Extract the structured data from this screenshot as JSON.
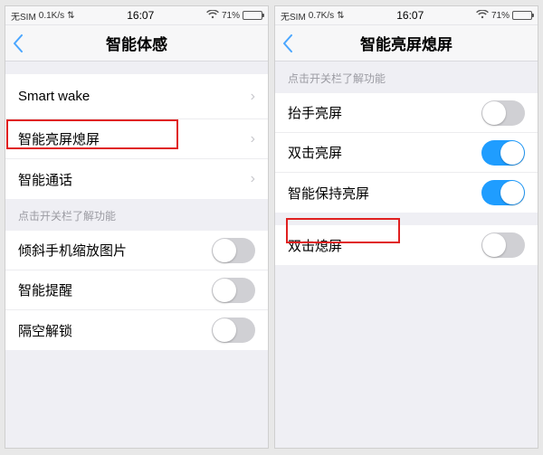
{
  "left": {
    "status": {
      "carrier": "无SIM",
      "net": "0.1K/s",
      "time": "16:07",
      "battery": "71%"
    },
    "title": "智能体感",
    "rows1": [
      {
        "label": "Smart wake"
      },
      {
        "label": "智能亮屏熄屏"
      },
      {
        "label": "智能通话"
      }
    ],
    "hint": "点击开关栏了解功能",
    "rows2": [
      {
        "label": "倾斜手机缩放图片",
        "on": false
      },
      {
        "label": "智能提醒",
        "on": false
      },
      {
        "label": "隔空解锁",
        "on": false
      }
    ]
  },
  "right": {
    "status": {
      "carrier": "无SIM",
      "net": "0.7K/s",
      "time": "16:07",
      "battery": "71%"
    },
    "title": "智能亮屏熄屏",
    "hint1": "点击开关栏了解功能",
    "rows1": [
      {
        "label": "抬手亮屏",
        "on": false
      },
      {
        "label": "双击亮屏",
        "on": true
      },
      {
        "label": "智能保持亮屏",
        "on": true
      }
    ],
    "rows2": [
      {
        "label": "双击熄屏",
        "on": false
      }
    ]
  }
}
